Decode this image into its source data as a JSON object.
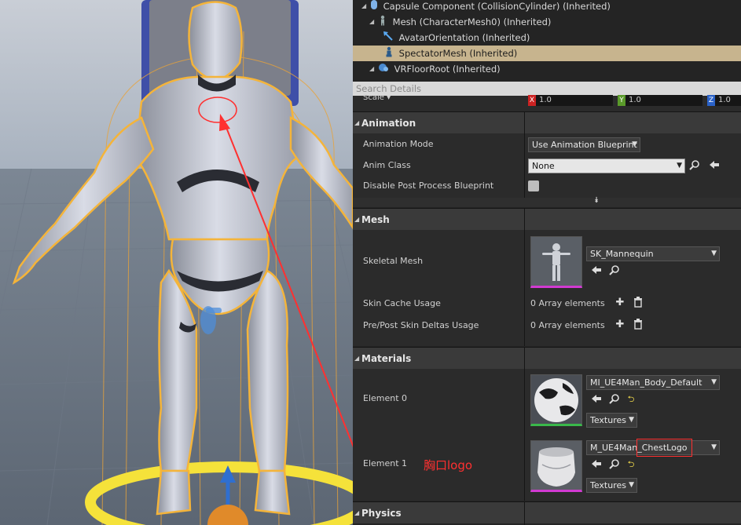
{
  "tree": {
    "items": [
      {
        "label": "Capsule Component (CollisionCylinder) (Inherited)"
      },
      {
        "label": "Mesh (CharacterMesh0) (Inherited)"
      },
      {
        "label": "AvatarOrientation (Inherited)"
      },
      {
        "label": "SpectatorMesh (Inherited)"
      },
      {
        "label": "VRFloorRoot (Inherited)"
      }
    ]
  },
  "search": {
    "placeholder": "Search Details"
  },
  "scale": {
    "label": "Scale",
    "x": "1.0",
    "y": "1.0",
    "z": "1.0",
    "x_axis": "X",
    "y_axis": "Y",
    "z_axis": "Z"
  },
  "animation": {
    "title": "Animation",
    "mode_label": "Animation Mode",
    "mode_value": "Use Animation Blueprint",
    "class_label": "Anim Class",
    "class_value": "None",
    "disable_pp_label": "Disable Post Process Blueprint"
  },
  "mesh": {
    "title": "Mesh",
    "skeletal_label": "Skeletal Mesh",
    "skeletal_value": "SK_Mannequin",
    "skin_cache_label": "Skin Cache Usage",
    "skin_cache_value": "0 Array elements",
    "prepost_label": "Pre/Post Skin Deltas Usage",
    "prepost_value": "0 Array elements"
  },
  "materials": {
    "title": "Materials",
    "element0_label": "Element 0",
    "element0_value": "MI_UE4Man_Body_Default",
    "element0_textures": "Textures",
    "element1_label": "Element 1",
    "element1_value": "M_UE4Man_ChestLogo",
    "element1_textures": "Textures"
  },
  "physics": {
    "title": "Physics"
  },
  "annotation": {
    "text": "胸口logo",
    "color": "#ff3030"
  },
  "colors": {
    "selection": "#c7b48e",
    "panel": "#242424",
    "highlight": "#f4b43a"
  }
}
